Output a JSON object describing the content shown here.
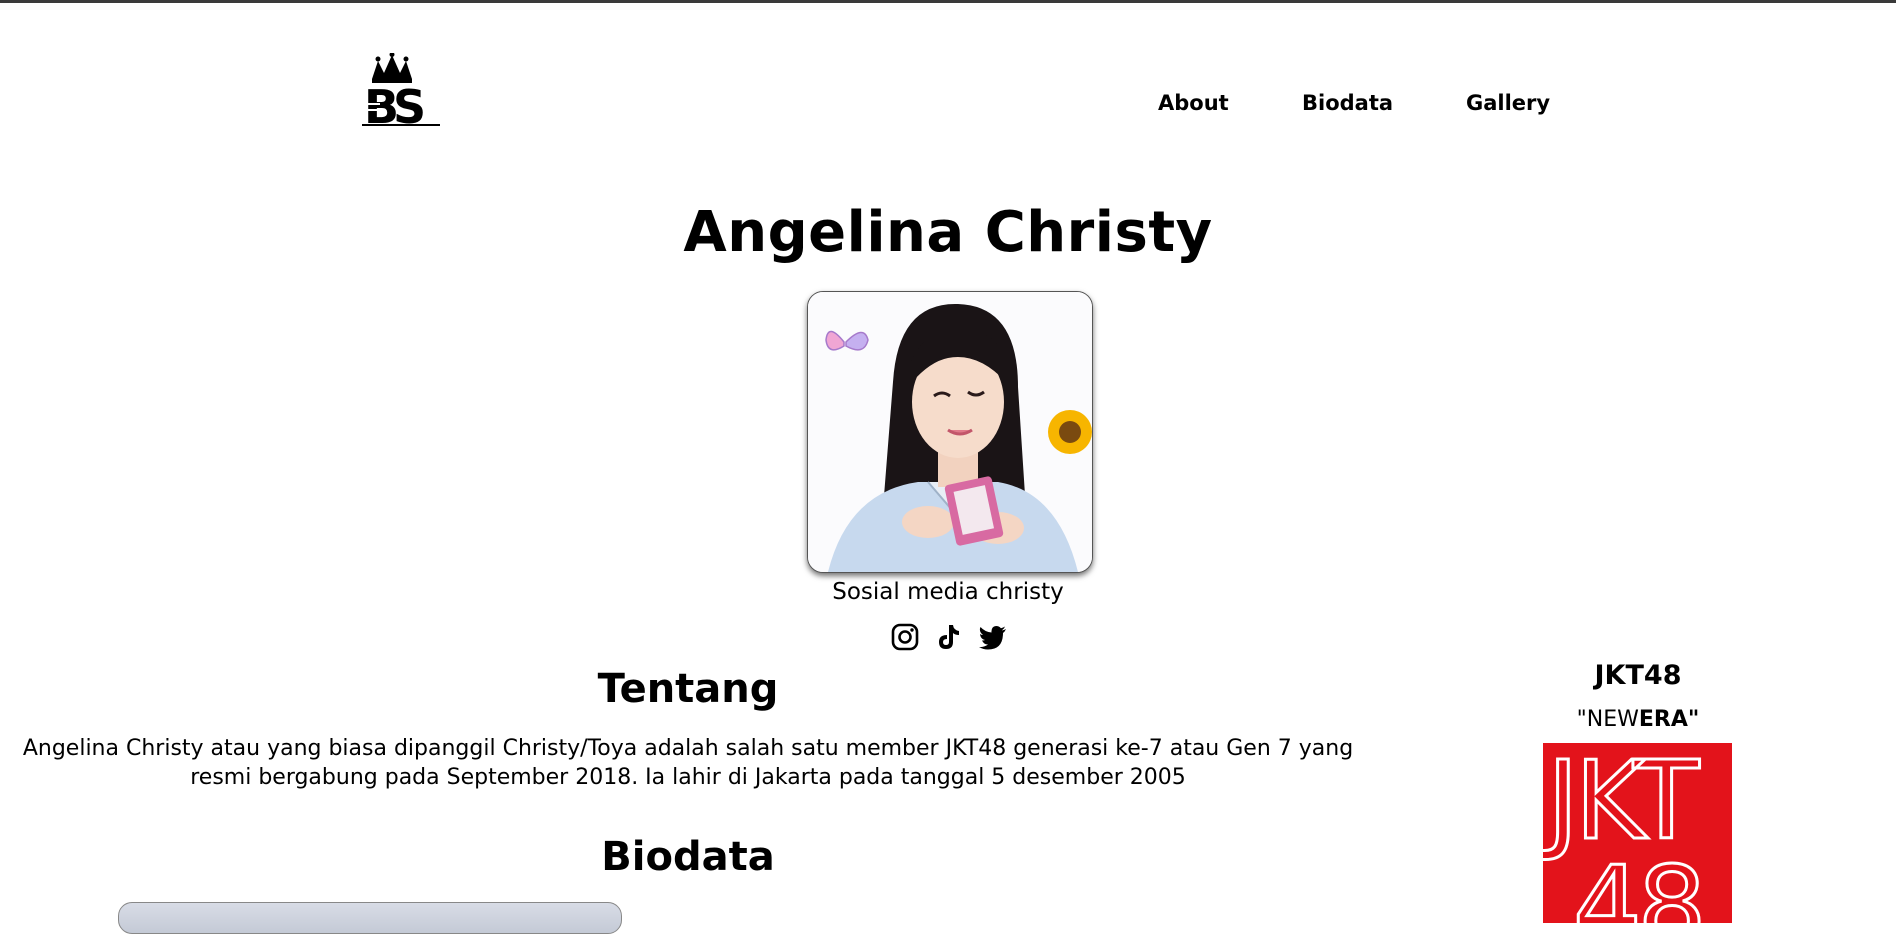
{
  "nav": {
    "logo_alt": "BS",
    "links": [
      "About",
      "Biodata",
      "Gallery"
    ]
  },
  "hero": {
    "name": "Angelina Christy",
    "social_caption": "Sosial media christy",
    "social_icons": [
      "instagram-icon",
      "tiktok-icon",
      "twitter-icon"
    ]
  },
  "about": {
    "heading": "Tentang",
    "text": "Angelina Christy atau yang biasa dipanggil Christy/Toya adalah salah satu member JKT48 generasi ke-7 atau Gen 7 yang resmi bergabung pada September 2018. Ia lahir di Jakarta pada tanggal 5 desember 2005"
  },
  "biodata": {
    "heading": "Biodata"
  },
  "sidebar": {
    "title": "JKT48",
    "subtitle_prefix": "\"NEW",
    "subtitle_bold": "ERA\"",
    "logo_text": "JKT48"
  },
  "colors": {
    "jkt_red": "#e3131b"
  }
}
